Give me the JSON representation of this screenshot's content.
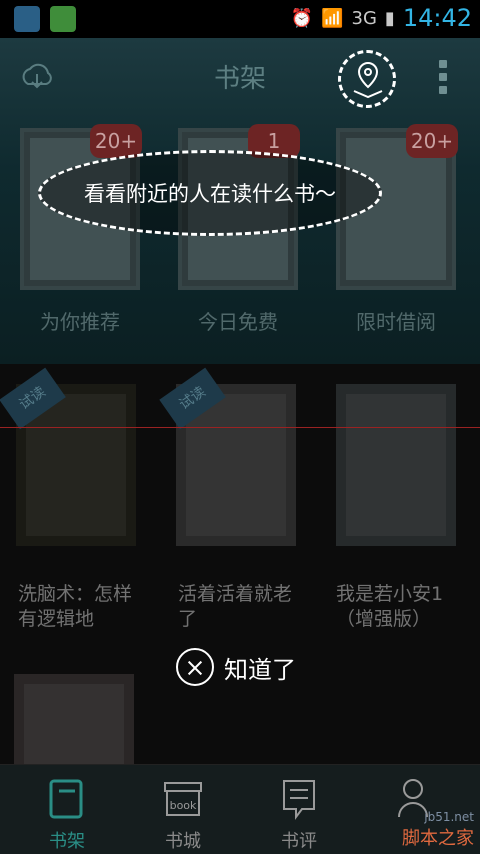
{
  "status": {
    "time": "14:42",
    "network": "3G"
  },
  "header": {
    "title": "书架"
  },
  "bubble": {
    "text": "看看附近的人在读什么书～"
  },
  "shelf": [
    {
      "caption": "为你推荐",
      "badge": "20+"
    },
    {
      "caption": "今日免费",
      "badge": "1"
    },
    {
      "caption": "限时借阅",
      "badge": "20+"
    }
  ],
  "books": [
    {
      "tag": "试读",
      "title": "洗脑术：怎样有逻辑地"
    },
    {
      "tag": "试读",
      "title": "活着活着就老了"
    },
    {
      "tag": "",
      "title": "我是若小安1（增强版）"
    }
  ],
  "dismiss": {
    "label": "知道了"
  },
  "nav": [
    {
      "label": "书架",
      "active": true
    },
    {
      "label": "书城",
      "active": false
    },
    {
      "label": "书评",
      "active": false
    },
    {
      "label": "",
      "active": false
    }
  ],
  "watermark": {
    "line1": "jb51.net",
    "line2": "脚本之家"
  },
  "colors": {
    "accent": "#2a8e86",
    "time": "#33b5e5"
  }
}
